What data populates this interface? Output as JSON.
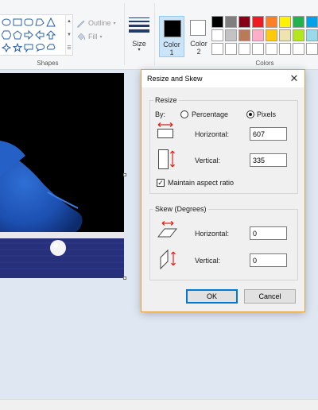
{
  "ribbon": {
    "shapes_group_label": "Shapes",
    "outline_label": "Outline",
    "fill_label": "Fill",
    "size_label": "Size",
    "color1_label": "Color 1",
    "color1_line1": "Color",
    "color1_line2": "1",
    "color2_line1": "Color",
    "color2_line2": "2",
    "colors_group_label": "Colors",
    "palette": [
      "#000000",
      "#7f7f7f",
      "#880015",
      "#ed1c24",
      "#ff7f27",
      "#fff200",
      "#22b14c",
      "#00a2e8",
      "#ffffff",
      "#c3c3c3",
      "#b97a57",
      "#ffaec9",
      "#ffc90e",
      "#efe4b0",
      "#b5e61d",
      "#99d9ea",
      "#ffffff",
      "#ffffff",
      "#ffffff",
      "#ffffff",
      "#ffffff",
      "#ffffff",
      "#ffffff",
      "#ffffff"
    ]
  },
  "dialog": {
    "title": "Resize and Skew",
    "resize_group": "Resize",
    "by_label": "By:",
    "percentage_label": "Percentage",
    "pixels_label": "Pixels",
    "selected_mode": "Pixels",
    "horizontal_label": "Horizontal:",
    "horizontal_value": "607",
    "vertical_label": "Vertical:",
    "vertical_value": "335",
    "maintain_label": "Maintain aspect ratio",
    "maintain_checked": true,
    "skew_group": "Skew (Degrees)",
    "skew_horizontal_label": "Horizontal:",
    "skew_horizontal_value": "0",
    "skew_vertical_label": "Vertical:",
    "skew_vertical_value": "0",
    "ok_label": "OK",
    "cancel_label": "Cancel"
  },
  "colors": {
    "accent_border": "#e6a13a",
    "selection": "#cce4f7",
    "red_arrow": "#e0201b"
  }
}
